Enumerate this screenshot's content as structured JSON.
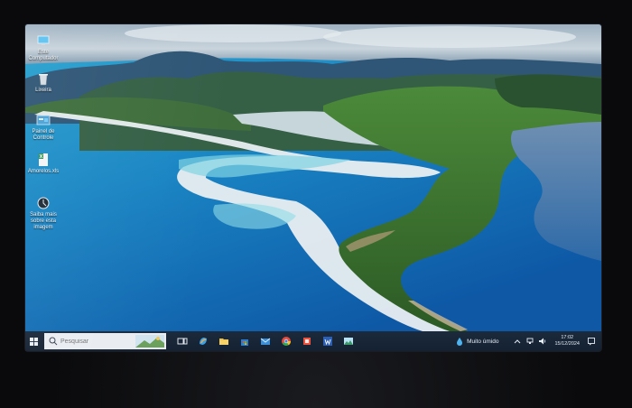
{
  "desktop": {
    "icons": [
      {
        "name": "computer-icon",
        "label": "Este Computador"
      },
      {
        "name": "recycle-bin-icon",
        "label": "Lixeira"
      },
      {
        "name": "control-panel-icon",
        "label": "Painel de Controle"
      },
      {
        "name": "spreadsheet-file-icon",
        "label": "Amorelos.xls"
      },
      {
        "name": "learn-about-image-icon",
        "label": "Saiba mais sobre esta imagem"
      }
    ]
  },
  "taskbar": {
    "search": {
      "placeholder": "Pesquisar"
    },
    "apps": [
      "task-view-icon",
      "copilot-icon",
      "file-explorer-icon",
      "store-icon",
      "mail-icon",
      "chrome-icon",
      "office-icon",
      "word-icon",
      "photos-icon"
    ],
    "weather": {
      "text": "Muito úmido"
    },
    "clock": {
      "time": "17:02",
      "date": "15/12/2024"
    }
  },
  "colors": {
    "taskbar": "#142132",
    "accent": "#3b8fd9"
  }
}
